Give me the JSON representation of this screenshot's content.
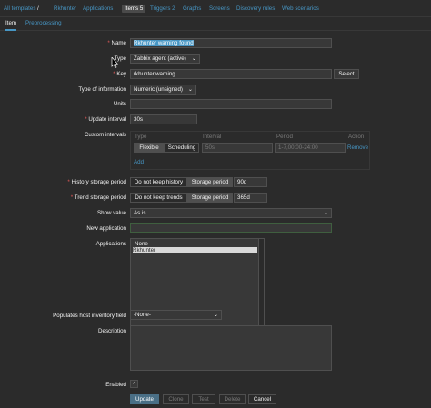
{
  "nav": {
    "all_templates": "All templates",
    "separator": "/",
    "host": "Rkhunter",
    "applications": "Applications",
    "items": "Items 5",
    "triggers": "Triggers 2",
    "graphs": "Graphs",
    "screens": "Screens",
    "discovery_rules": "Discovery rules",
    "web_scenarios": "Web scenarios"
  },
  "tabs": [
    "Item",
    "Preprocessing"
  ],
  "form": {
    "name_label": "Name",
    "name_value": "Rkhunter warning found",
    "type_label": "Type",
    "type_value": "Zabbix agent (active)",
    "key_label": "Key",
    "key_value": "rkhunter.warning",
    "select_button": "Select",
    "type_of_info_label": "Type of information",
    "type_of_info_value": "Numeric (unsigned)",
    "units_label": "Units",
    "units_value": "",
    "update_interval_label": "Update interval",
    "update_interval_value": "30s",
    "custom_intervals_label": "Custom intervals",
    "ci_headers": {
      "type": "Type",
      "interval": "Interval",
      "period": "Period",
      "action": "Action"
    },
    "ci_row": {
      "flexible": "Flexible",
      "scheduling": "Scheduling",
      "interval": "50s",
      "period": "1-7,00:00-24:00",
      "remove": "Remove"
    },
    "ci_add": "Add",
    "history_label": "History storage period",
    "history_opt1": "Do not keep history",
    "history_opt2": "Storage period",
    "history_value": "90d",
    "trend_label": "Trend storage period",
    "trend_opt1": "Do not keep trends",
    "trend_opt2": "Storage period",
    "trend_value": "365d",
    "show_value_label": "Show value",
    "show_value_value": "As is",
    "new_app_label": "New application",
    "new_app_value": "",
    "applications_label": "Applications",
    "applications_options": [
      "-None-",
      "Rkhunter"
    ],
    "inventory_label": "Populates host inventory field",
    "inventory_value": "-None-",
    "description_label": "Description",
    "enabled_label": "Enabled",
    "enabled_checked": "✓"
  },
  "footer_buttons": {
    "update": "Update",
    "clone": "Clone",
    "test": "Test",
    "delete": "Delete",
    "cancel": "Cancel"
  },
  "chevron": "⌄"
}
